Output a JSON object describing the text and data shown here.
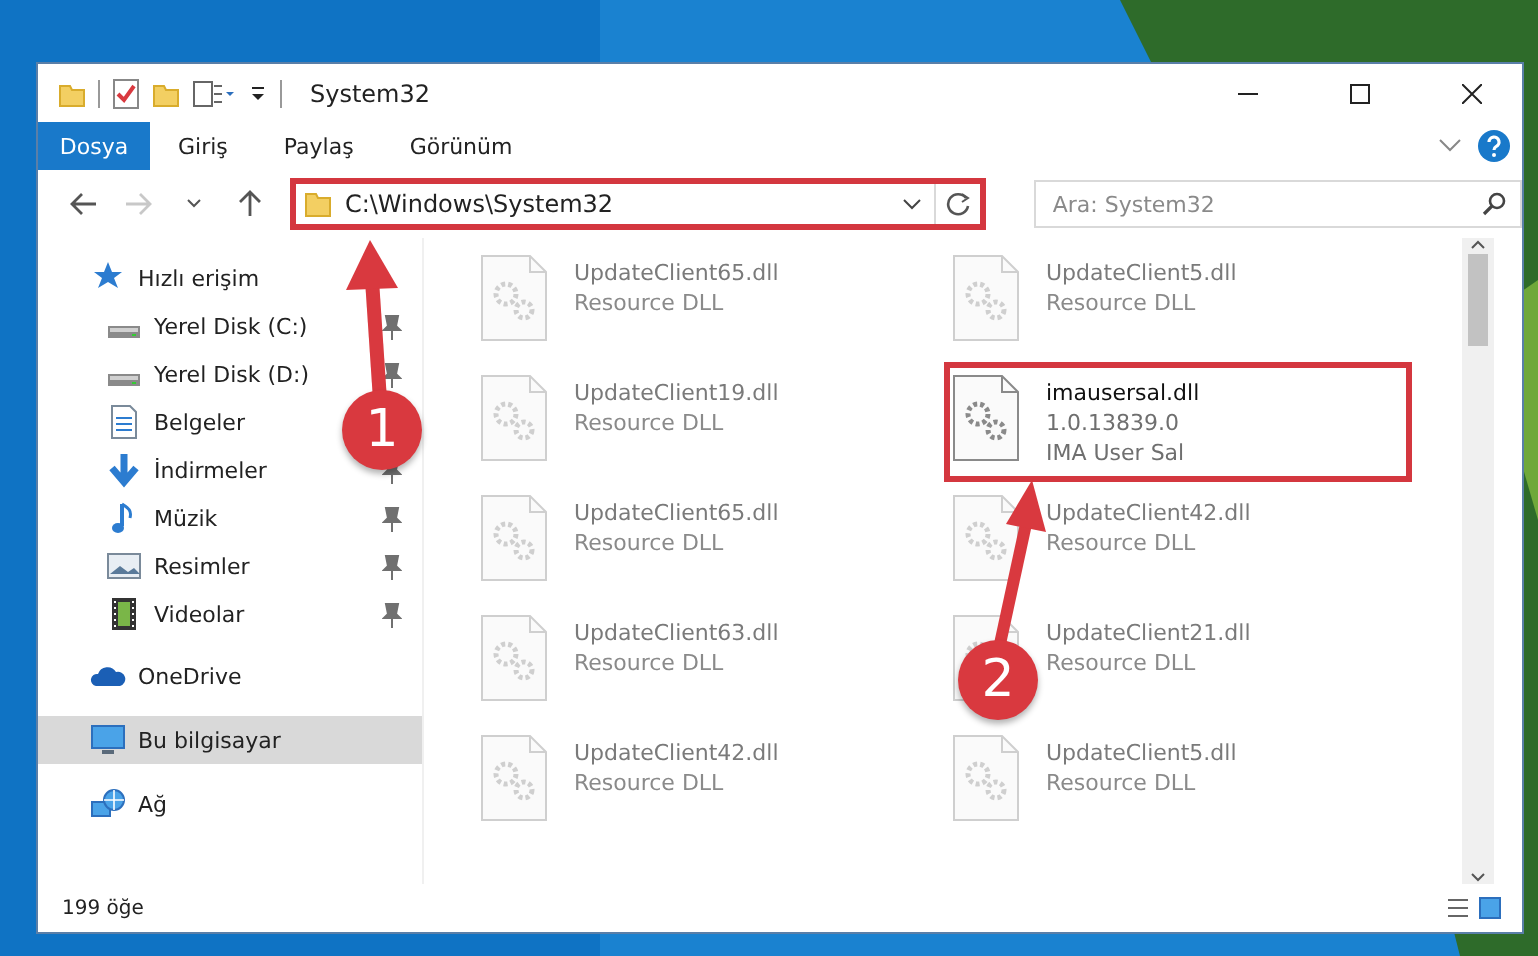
{
  "window": {
    "title": "System32"
  },
  "ribbon_tabs": [
    {
      "label": "Dosya",
      "kind": "file"
    },
    {
      "label": "Giriş",
      "kind": "tab"
    },
    {
      "label": "Paylaş",
      "kind": "tab"
    },
    {
      "label": "Görünüm",
      "kind": "tab"
    }
  ],
  "address": {
    "path": "C:\\Windows\\System32",
    "highlighted": true
  },
  "search": {
    "placeholder": "Ara: System32"
  },
  "nav": [
    {
      "label": "Hızlı erişim",
      "kind": "star",
      "selected": false,
      "children": [
        {
          "label": "Yerel Disk (C:)",
          "kind": "drive",
          "selected": false,
          "pinned": true
        },
        {
          "label": "Yerel Disk (D:)",
          "kind": "drive",
          "selected": false,
          "pinned": true
        },
        {
          "label": "Belgeler",
          "kind": "document",
          "selected": false
        },
        {
          "label": "İndirmeler",
          "kind": "download",
          "selected": false,
          "pinned": true
        },
        {
          "label": "Müzik",
          "kind": "music",
          "selected": false,
          "pinned": true
        },
        {
          "label": "Resimler",
          "kind": "pictures",
          "selected": false,
          "pinned": true
        },
        {
          "label": "Videolar",
          "kind": "video",
          "selected": false,
          "pinned": true
        }
      ]
    },
    {
      "label": "OneDrive",
      "kind": "cloud",
      "selected": false
    },
    {
      "label": "Bu bilgisayar",
      "kind": "computer",
      "selected": true
    },
    {
      "label": "Ağ",
      "kind": "network",
      "selected": false
    }
  ],
  "files": [
    {
      "name": "UpdateClient65.dll",
      "details": [
        "Resource DLL"
      ],
      "blurred": true,
      "highlighted": false
    },
    {
      "name": "UpdateClient5.dll",
      "details": [
        "Resource DLL"
      ],
      "blurred": true,
      "highlighted": false
    },
    {
      "name": "UpdateClient19.dll",
      "details": [
        "Resource DLL"
      ],
      "blurred": true,
      "highlighted": false
    },
    {
      "name": "imausersal.dll",
      "details": [
        "1.0.13839.0",
        "IMA User Sal"
      ],
      "blurred": false,
      "highlighted": true
    },
    {
      "name": "UpdateClient65.dll",
      "details": [
        "Resource DLL"
      ],
      "blurred": true,
      "highlighted": false
    },
    {
      "name": "UpdateClient42.dll",
      "details": [
        "Resource DLL"
      ],
      "blurred": true,
      "highlighted": false
    },
    {
      "name": "UpdateClient63.dll",
      "details": [
        "Resource DLL"
      ],
      "blurred": true,
      "highlighted": false
    },
    {
      "name": "UpdateClient21.dll",
      "details": [
        "Resource DLL"
      ],
      "blurred": true,
      "highlighted": false
    },
    {
      "name": "UpdateClient42.dll",
      "details": [
        "Resource DLL"
      ],
      "blurred": true,
      "highlighted": false
    },
    {
      "name": "UpdateClient5.dll",
      "details": [
        "Resource DLL"
      ],
      "blurred": true,
      "highlighted": false
    }
  ],
  "status_bar": {
    "count": "199 öğe"
  },
  "annotations": [
    {
      "number": "1"
    },
    {
      "number": "2"
    }
  ]
}
